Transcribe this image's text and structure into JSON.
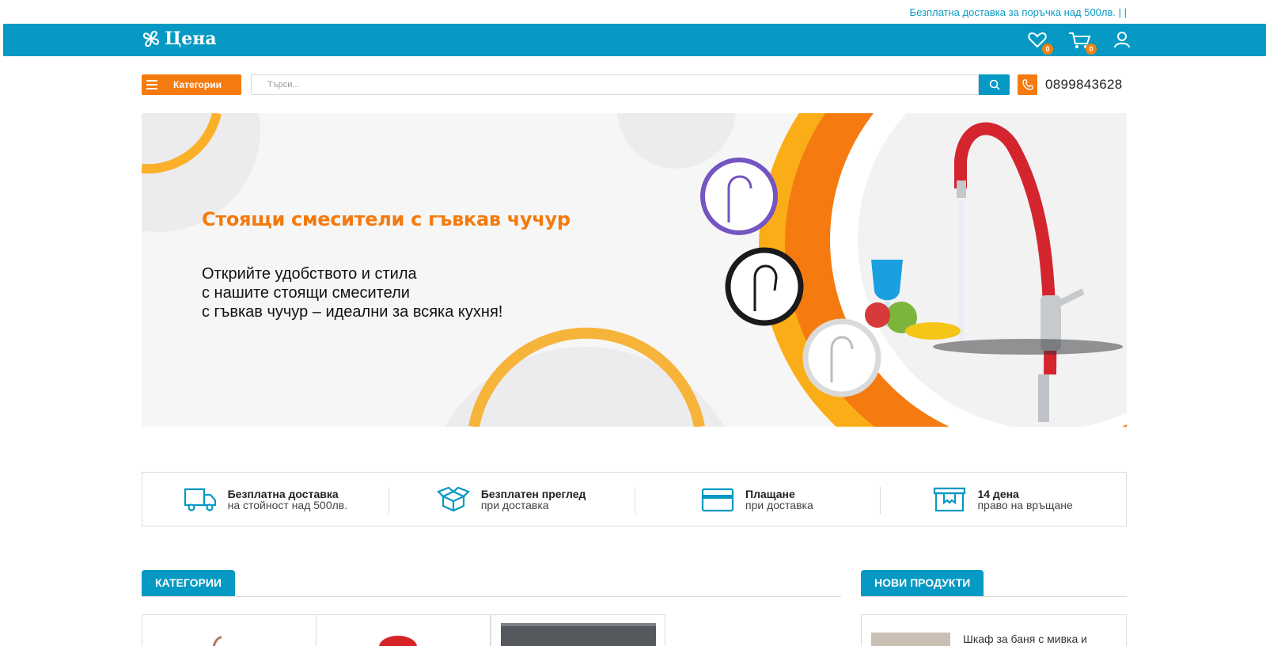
{
  "promo": {
    "text": "Безплатна доставка за поръчка над 500лв. | |"
  },
  "header": {
    "logo_text": "Цена",
    "wishlist_count": "0",
    "cart_count": "0"
  },
  "toolbar": {
    "categories_label": "Категории",
    "search_placeholder": "Търси...",
    "phone": "0899843628"
  },
  "banner": {
    "title": "Стоящи смесители с гъвкав чучур",
    "lines": [
      "Открийте удобството и стила",
      "с нашите стоящи смесители",
      "с гъвкав чучур – идеални за всяка кухня!"
    ]
  },
  "features": [
    {
      "icon": "truck-icon",
      "line1": "Безплатна доставка",
      "line2": "на стойност над 500лв."
    },
    {
      "icon": "open-box-icon",
      "line1": "Безплатен преглед",
      "line2": "при доставка"
    },
    {
      "icon": "credit-card-icon",
      "line1": "Плащане",
      "line2": "при доставка"
    },
    {
      "icon": "return-box-icon",
      "line1": "14 дена",
      "line2": "право на връщане"
    }
  ],
  "sections": {
    "categories": "КАТЕГОРИИ",
    "new_products": "НОВИ ПРОДУКТИ"
  },
  "new_products": [
    {
      "title": "Шкаф за баня с мивка и"
    }
  ],
  "colors": {
    "primary": "#0599c3",
    "accent": "#f57b10",
    "text": "#222222"
  }
}
